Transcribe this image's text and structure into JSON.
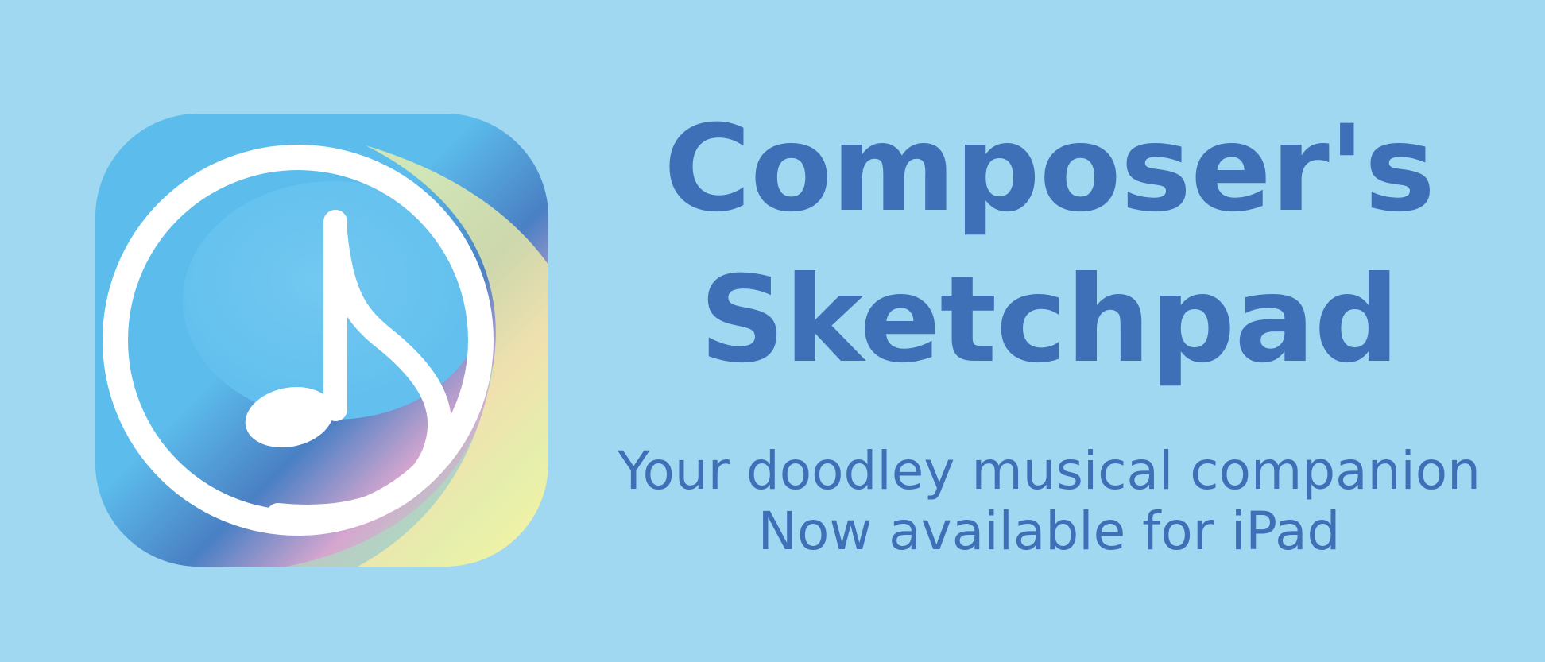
{
  "banner": {
    "title_line_1": "Composer's",
    "title_line_2": "Sketchpad",
    "tagline": "Your doodley musical companion",
    "availability": "Now available for iPad"
  },
  "app_icon": {
    "icon": "eighth-note-icon",
    "colors": {
      "background": "#a0d7f1",
      "text": "#3d70b7",
      "icon_sky": "#5cbdec",
      "icon_deep_blue": "#4a80c4",
      "icon_pink": "#d6a6cf",
      "icon_green": "#acdcc0",
      "icon_yellow": "#f8f4a4",
      "note": "#ffffff"
    }
  }
}
